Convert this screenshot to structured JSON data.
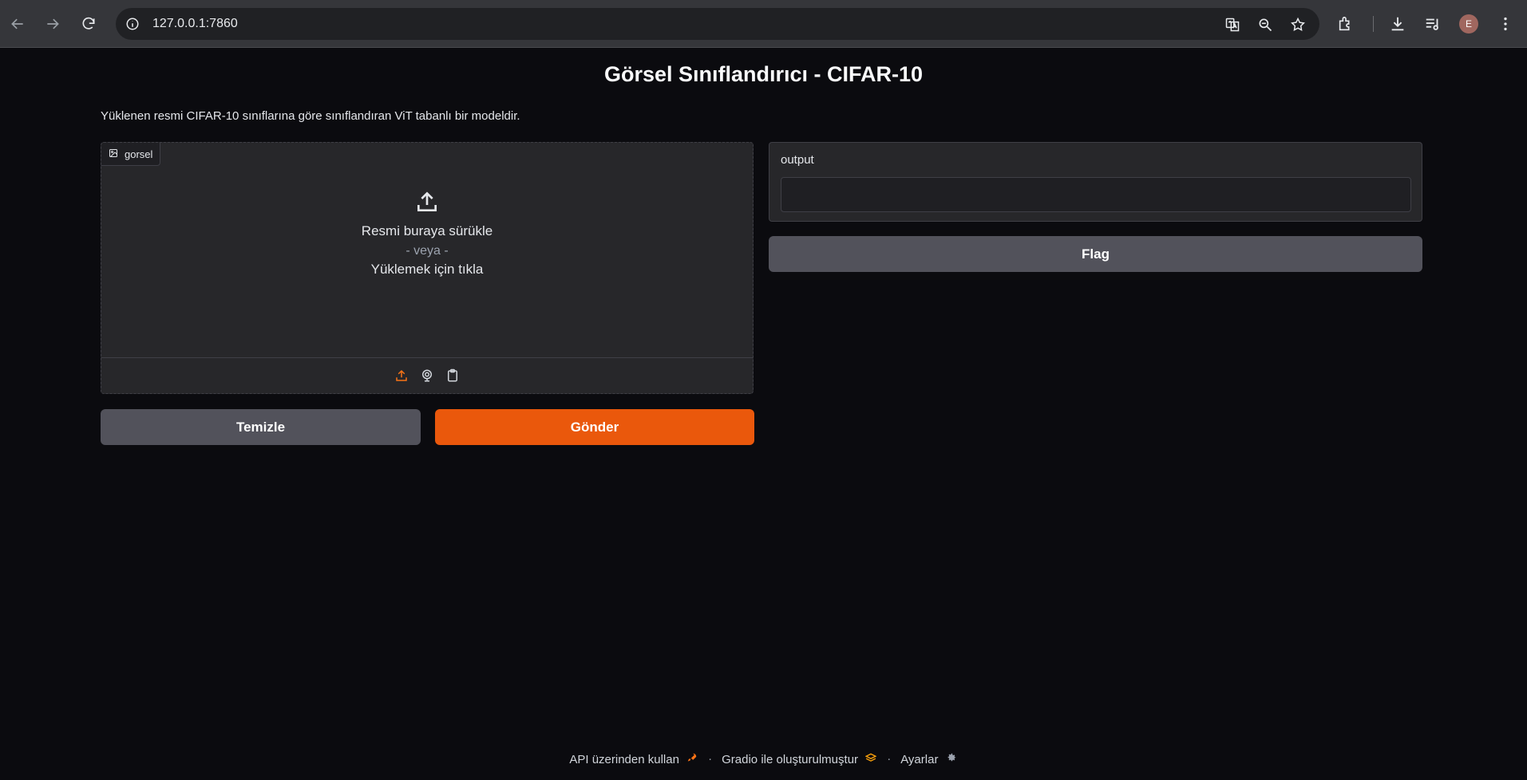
{
  "browser": {
    "url": "127.0.0.1:7860",
    "avatar_letter": "E"
  },
  "app": {
    "title": "Görsel Sınıflandırıcı - CIFAR-10",
    "description": "Yüklenen resmi CIFAR-10 sınıflarına göre sınıflandıran ViT tabanlı bir modeldir.",
    "image_input": {
      "label": "gorsel",
      "drag_text": "Resmi buraya sürükle",
      "or_text": "- veya -",
      "click_text": "Yüklemek için tıkla",
      "sources": [
        "upload-icon",
        "webcam-icon",
        "clipboard-icon"
      ],
      "active_source": "upload"
    },
    "buttons": {
      "clear": "Temizle",
      "submit": "Gönder",
      "flag": "Flag"
    },
    "output": {
      "label": "output",
      "value": ""
    },
    "colors": {
      "accent": "#ea580c",
      "secondary_button": "#52525b",
      "background": "#0b0b0f",
      "panel": "#27272a"
    }
  },
  "footer": {
    "api": "API üzerinden kullan",
    "separator": "·",
    "gradio": "Gradio ile oluşturulmuştur",
    "settings": "Ayarlar"
  }
}
